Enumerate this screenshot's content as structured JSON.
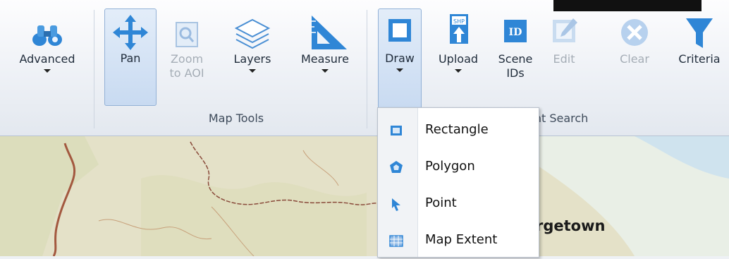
{
  "ribbon": {
    "buttons": {
      "advanced": "Advanced",
      "pan": "Pan",
      "zoom_aoi_1": "Zoom",
      "zoom_aoi_2": "to AOI",
      "layers": "Layers",
      "measure": "Measure",
      "draw": "Draw",
      "upload": "Upload",
      "scene_ids_1": "Scene",
      "scene_ids_2": "IDs",
      "edit": "Edit",
      "clear": "Clear",
      "criteria": "Criteria"
    },
    "groups": {
      "map_tools": "Map Tools",
      "search_partial": "ent Search"
    },
    "icons": {
      "upload_badge": "SHP",
      "scene_badge": "ID"
    }
  },
  "draw_menu": {
    "items": [
      {
        "label": "Rectangle",
        "icon": "rectangle-icon"
      },
      {
        "label": "Polygon",
        "icon": "polygon-icon"
      },
      {
        "label": "Point",
        "icon": "point-icon"
      },
      {
        "label": "Map Extent",
        "icon": "map-extent-icon"
      }
    ]
  },
  "map": {
    "city_label": "rgetown"
  },
  "colors": {
    "accent": "#2f86d6",
    "disabled": "#a5adb6",
    "map_land": "#e4e1c8",
    "map_water": "#cfe3ee",
    "border_line": "#8a4b3b"
  }
}
